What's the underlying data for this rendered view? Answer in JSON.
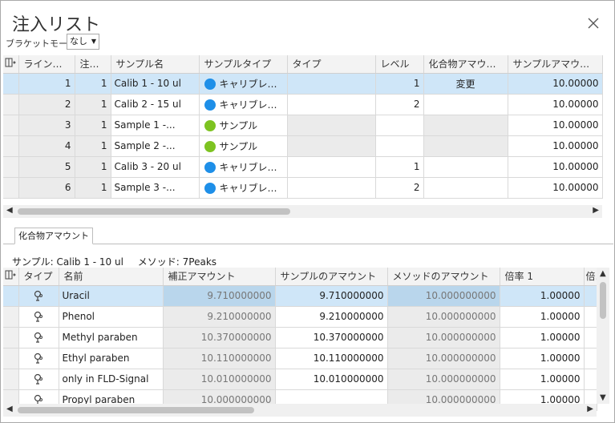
{
  "window": {
    "title": "注入リスト"
  },
  "bracket": {
    "label": "ブラケットモード",
    "value": "なし"
  },
  "top_grid": {
    "columns": [
      "ライン番号",
      "注入...",
      "サンプル名",
      "サンプルタイプ",
      "タイプ",
      "レベル",
      "化合物アマウント",
      "サンプルアマウント"
    ],
    "rows": [
      {
        "line": "1",
        "inj": "1",
        "name": "Calib 1 - 10 ul",
        "type_color": "#1e8fe8",
        "type": "キャリブレーシ...",
        "kind": "",
        "level": "1",
        "compound": "変更",
        "amount": "10.00000"
      },
      {
        "line": "2",
        "inj": "1",
        "name": "Calib 2 - 15 ul",
        "type_color": "#1e8fe8",
        "type": "キャリブレーシ...",
        "kind": "",
        "level": "2",
        "compound": "",
        "amount": "10.00000"
      },
      {
        "line": "3",
        "inj": "1",
        "name": "Sample 1 -...",
        "type_color": "#7dc321",
        "type": "サンプル",
        "kind": "",
        "level": "",
        "compound": "",
        "amount": "10.00000"
      },
      {
        "line": "4",
        "inj": "1",
        "name": "Sample 2 -...",
        "type_color": "#7dc321",
        "type": "サンプル",
        "kind": "",
        "level": "",
        "compound": "",
        "amount": "10.00000"
      },
      {
        "line": "5",
        "inj": "1",
        "name": "Calib 3 - 20 ul",
        "type_color": "#1e8fe8",
        "type": "キャリブレーシ...",
        "kind": "",
        "level": "1",
        "compound": "",
        "amount": "10.00000"
      },
      {
        "line": "6",
        "inj": "1",
        "name": "Sample 3 -...",
        "type_color": "#1e8fe8",
        "type": "キャリブレーシ...",
        "kind": "",
        "level": "2",
        "compound": "",
        "amount": "10.00000"
      }
    ]
  },
  "tab": {
    "label": "化合物アマウント"
  },
  "info": {
    "sample": "サンプル: Calib 1 - 10 ul",
    "method": "メソッド: 7Peaks"
  },
  "bottom_grid": {
    "columns": [
      "タイプ",
      "名前",
      "補正アマウント",
      "サンプルのアマウント",
      "メソッドのアマウント",
      "倍率 1",
      "倍"
    ],
    "rows": [
      {
        "name": "Uracil",
        "corr": "9.710000000",
        "sample": "9.710000000",
        "method": "10.000000000",
        "factor": "1.00000"
      },
      {
        "name": "Phenol",
        "corr": "9.210000000",
        "sample": "9.210000000",
        "method": "10.000000000",
        "factor": "1.00000"
      },
      {
        "name": "Methyl paraben",
        "corr": "10.370000000",
        "sample": "10.370000000",
        "method": "10.000000000",
        "factor": "1.00000"
      },
      {
        "name": "Ethyl paraben",
        "corr": "10.110000000",
        "sample": "10.110000000",
        "method": "10.000000000",
        "factor": "1.00000"
      },
      {
        "name": "only in FLD-Signal",
        "corr": "10.010000000",
        "sample": "10.010000000",
        "method": "10.000000000",
        "factor": "1.00000"
      },
      {
        "name": "Propyl paraben",
        "corr": "10.000000000",
        "sample": "",
        "method": "10.000000000",
        "factor": "1.00000"
      }
    ]
  },
  "icons": {
    "close": "close-icon",
    "column_chooser": "column-chooser-icon",
    "compound": "compound-icon"
  }
}
